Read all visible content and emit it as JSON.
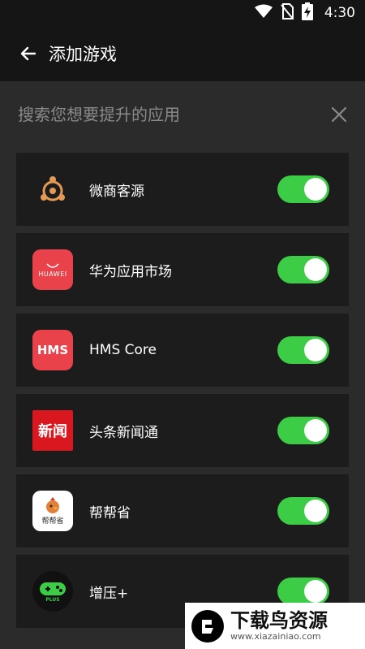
{
  "statusbar": {
    "time": "4:30",
    "wifi_icon": "wifi-icon",
    "signal_icon": "no-sim-icon",
    "battery_icon": "battery-charging-icon"
  },
  "appbar": {
    "title": "添加游戏",
    "back_icon": "arrow-left-icon"
  },
  "search": {
    "placeholder": "搜索您想要提升的应用",
    "value": "",
    "clear_icon": "close-icon"
  },
  "apps": [
    {
      "name": "微商客源",
      "enabled": true,
      "icon": "weishang-icon"
    },
    {
      "name": "华为应用市场",
      "enabled": true,
      "icon": "huawei-appgallery-icon",
      "icon_text": "HUAWEI"
    },
    {
      "name": "HMS Core",
      "enabled": true,
      "icon": "hms-core-icon",
      "icon_text": "HMS"
    },
    {
      "name": "头条新闻通",
      "enabled": true,
      "icon": "toutiao-news-icon",
      "icon_text": "新闻"
    },
    {
      "name": "帮帮省",
      "enabled": true,
      "icon": "bangbangsheng-icon",
      "icon_text": "帮帮省"
    },
    {
      "name": "增压+",
      "enabled": true,
      "icon": "gamepad-plus-icon",
      "icon_text": "PLUS"
    }
  ],
  "watermark": {
    "title": "下载鸟资源",
    "url": "www.xiazainiao.com"
  },
  "colors": {
    "toggle_on": "#3ccc46",
    "card_bg": "#1c1c1c",
    "page_bg": "#2b2b2b",
    "bar_bg": "#151515"
  }
}
